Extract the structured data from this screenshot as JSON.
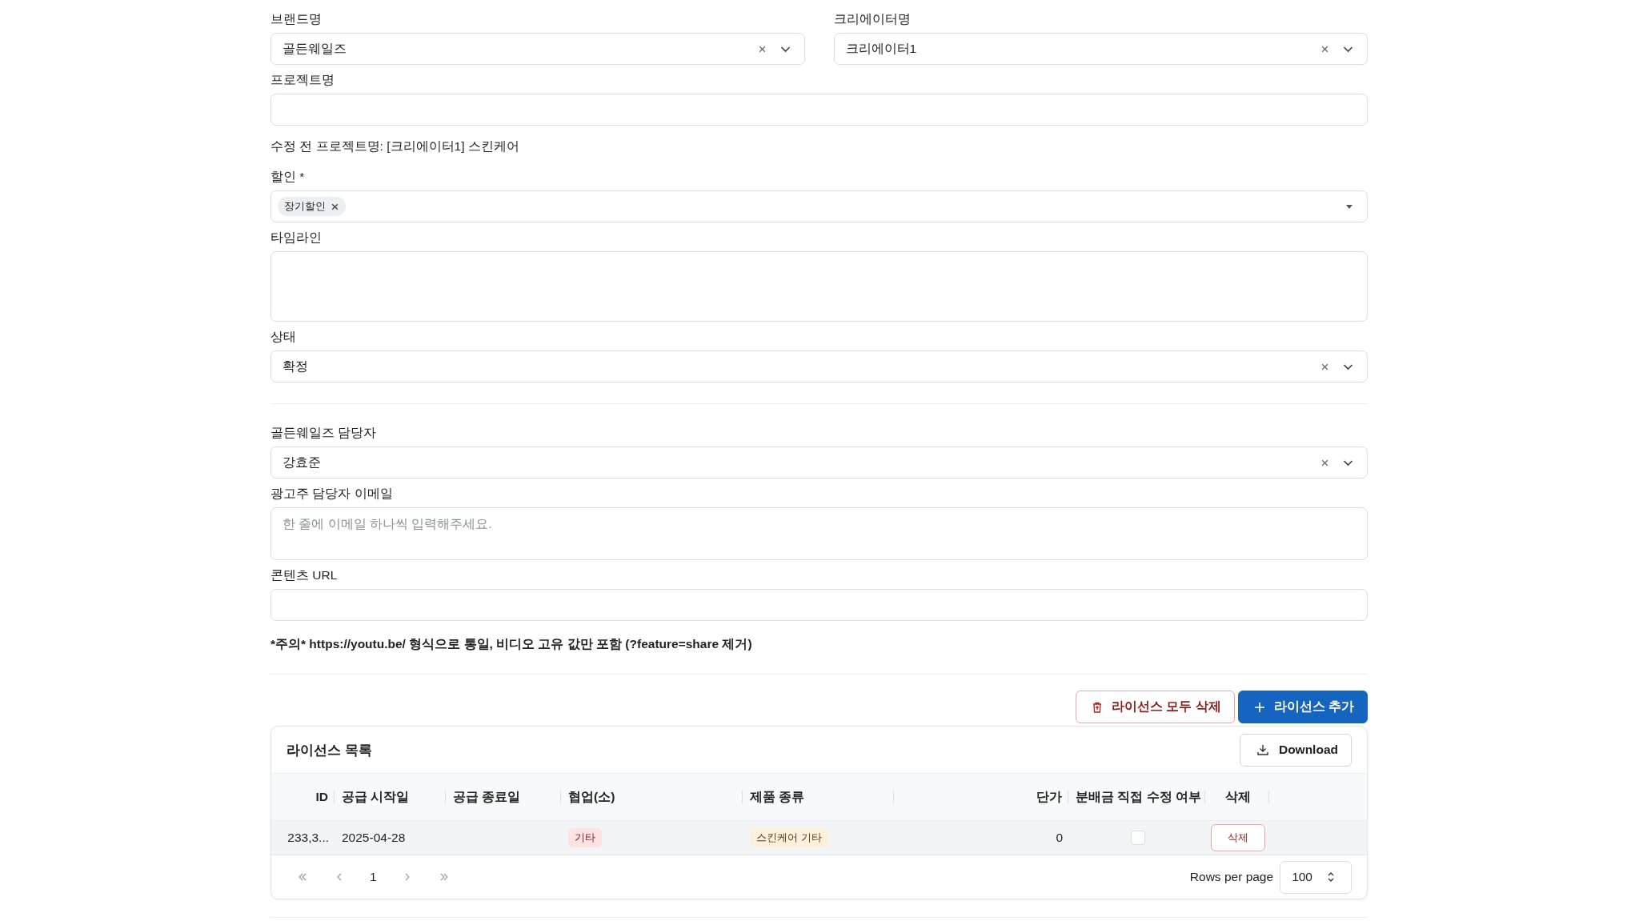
{
  "top_fields": [
    {
      "label": "브랜드명",
      "value": "골든웨일즈"
    },
    {
      "label": "크리에이터명",
      "value": "크리에이터1"
    }
  ],
  "project_name": {
    "label": "프로젝트명"
  },
  "previous_project_name": "수정 전 프로젝트명: [크리에이터1] 스킨케어",
  "discount": {
    "label": "할인 *",
    "tags": [
      "장기할인"
    ]
  },
  "timeline": {
    "label": "타임라인"
  },
  "status": {
    "label": "상태",
    "value": "확정"
  },
  "manager": {
    "label": "골든웨일즈 담당자",
    "value": "강효준"
  },
  "advertiser_email": {
    "label": "광고주 담당자 이메일",
    "placeholder": "한 줄에 이메일 하나씩 입력해주세요."
  },
  "content_url": {
    "label": "콘텐츠 URL"
  },
  "notice": "*주의* https://youtu.be/ 형식으로 통일, 비디오 고유 값만 포함 (?feature=share 제거)",
  "actions": [
    {
      "kind": "danger",
      "label": "라이선스 모두 삭제"
    },
    {
      "kind": "primary",
      "label": "라이선스 추가"
    }
  ],
  "license_table": {
    "title": "라이선스 목록",
    "download": "Download",
    "columns": [
      "ID",
      "공급 시작일",
      "공급 종료일",
      "협업(소)",
      "제품 종류",
      "단가",
      "분배금 직접 수정 여부",
      "삭제"
    ],
    "rows": [
      {
        "id": "233,3...",
        "start_date": "2025-04-28",
        "collab": "기타",
        "product": "스킨케어 기타",
        "price": "0",
        "direct_edit": false,
        "delete": "삭제"
      }
    ],
    "page": "1",
    "rows_per_page_label": "Rows per page",
    "rows_per_page": "100"
  }
}
